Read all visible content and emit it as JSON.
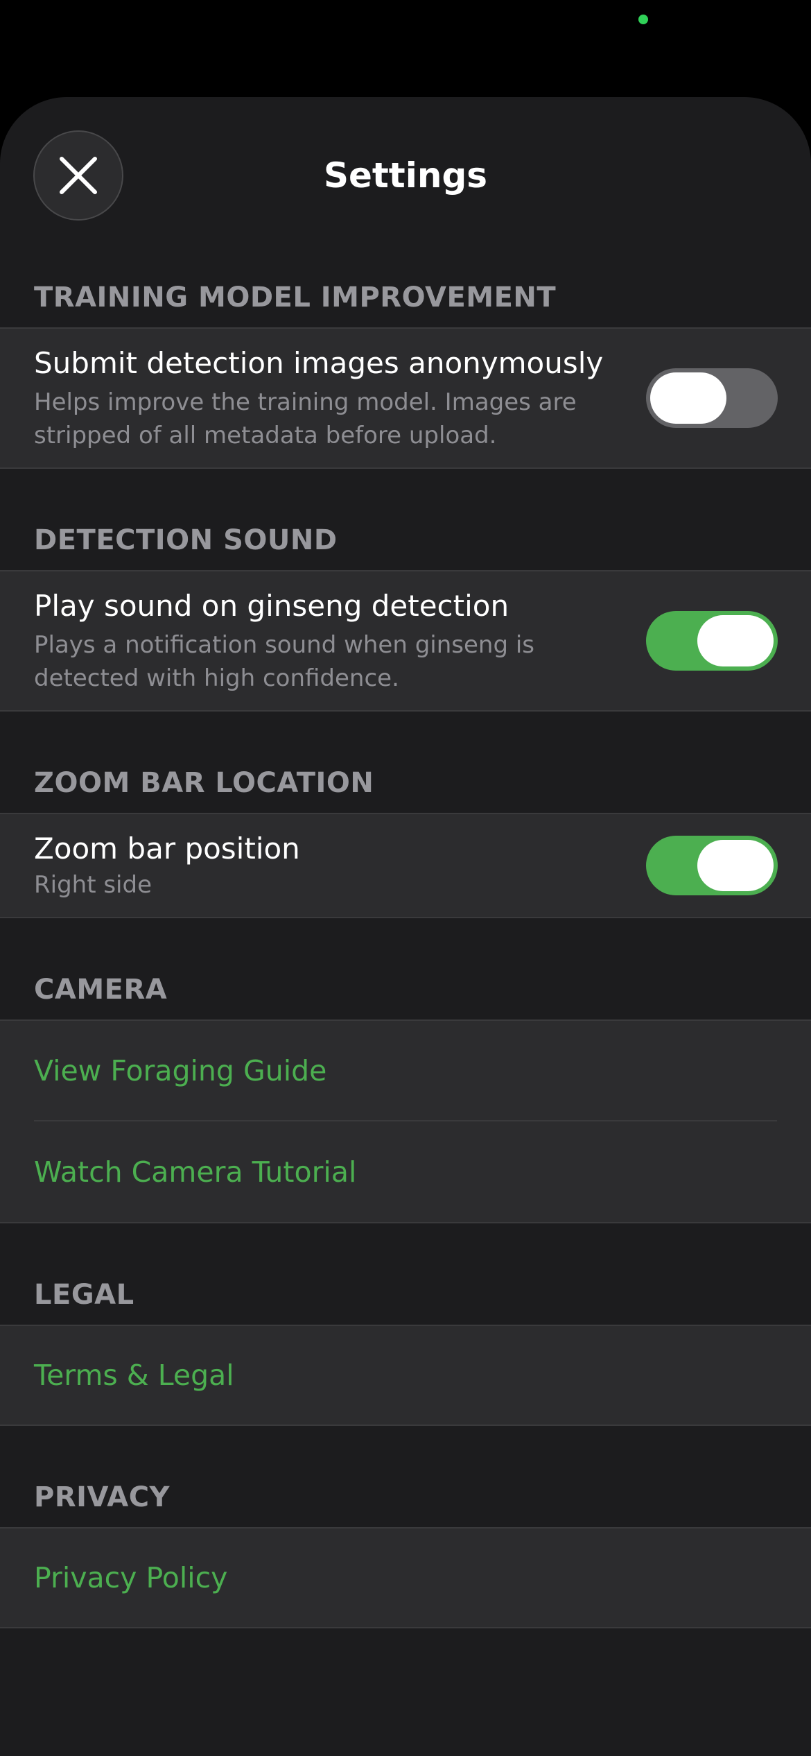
{
  "colors": {
    "accent": "#4caf50",
    "background": "#1c1c1e",
    "cell": "#2c2c2e",
    "section_header": "#98989d"
  },
  "header": {
    "title": "Settings",
    "close_icon": "close-icon"
  },
  "sections": {
    "training": {
      "header": "TRAINING MODEL IMPROVEMENT",
      "title": "Submit detection images anonymously",
      "subtitle_line1": "Helps improve the training model. Images are",
      "subtitle_line2": "stripped of all metadata before upload.",
      "toggle_on": false
    },
    "sound": {
      "header": "DETECTION SOUND",
      "title": "Play sound on ginseng detection",
      "subtitle_line1": "Plays a notification sound when ginseng is",
      "subtitle_line2": "detected with high confidence.",
      "toggle_on": true
    },
    "zoom": {
      "header": "ZOOM BAR LOCATION",
      "title": "Zoom bar position",
      "subtitle": "Right side",
      "toggle_on": true
    },
    "camera": {
      "header": "CAMERA",
      "links": [
        "View Foraging Guide",
        "Watch Camera Tutorial"
      ]
    },
    "legal": {
      "header": "LEGAL",
      "link": "Terms & Legal"
    },
    "privacy": {
      "header": "PRIVACY",
      "link": "Privacy Policy"
    }
  }
}
